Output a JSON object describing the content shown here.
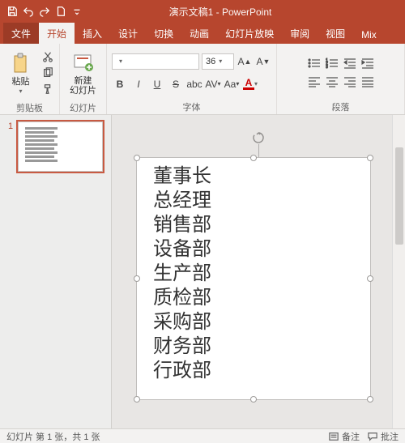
{
  "titlebar": {
    "title": "演示文稿1 - PowerPoint"
  },
  "tabs": {
    "file": "文件",
    "home": "开始",
    "insert": "插入",
    "design": "设计",
    "transitions": "切换",
    "animations": "动画",
    "slideshow": "幻灯片放映",
    "review": "审阅",
    "view": "视图",
    "mix": "Mix"
  },
  "ribbon": {
    "clipboard": {
      "paste": "粘贴",
      "label": "剪贴板"
    },
    "slides": {
      "newslide": "新建\n幻灯片",
      "label": "幻灯片"
    },
    "font": {
      "name": "",
      "size": "36",
      "label": "字体"
    },
    "paragraph": {
      "label": "段落"
    }
  },
  "thumbnail": {
    "number": "1"
  },
  "textbox": {
    "lines": [
      "董事长",
      "总经理",
      "销售部",
      "设备部",
      "生产部",
      "质检部",
      "采购部",
      "财务部",
      "行政部"
    ]
  },
  "status": {
    "slideinfo": "幻灯片 第 1 张，共 1 张",
    "notes": "备注",
    "comments": "批注"
  },
  "chart_data": null
}
